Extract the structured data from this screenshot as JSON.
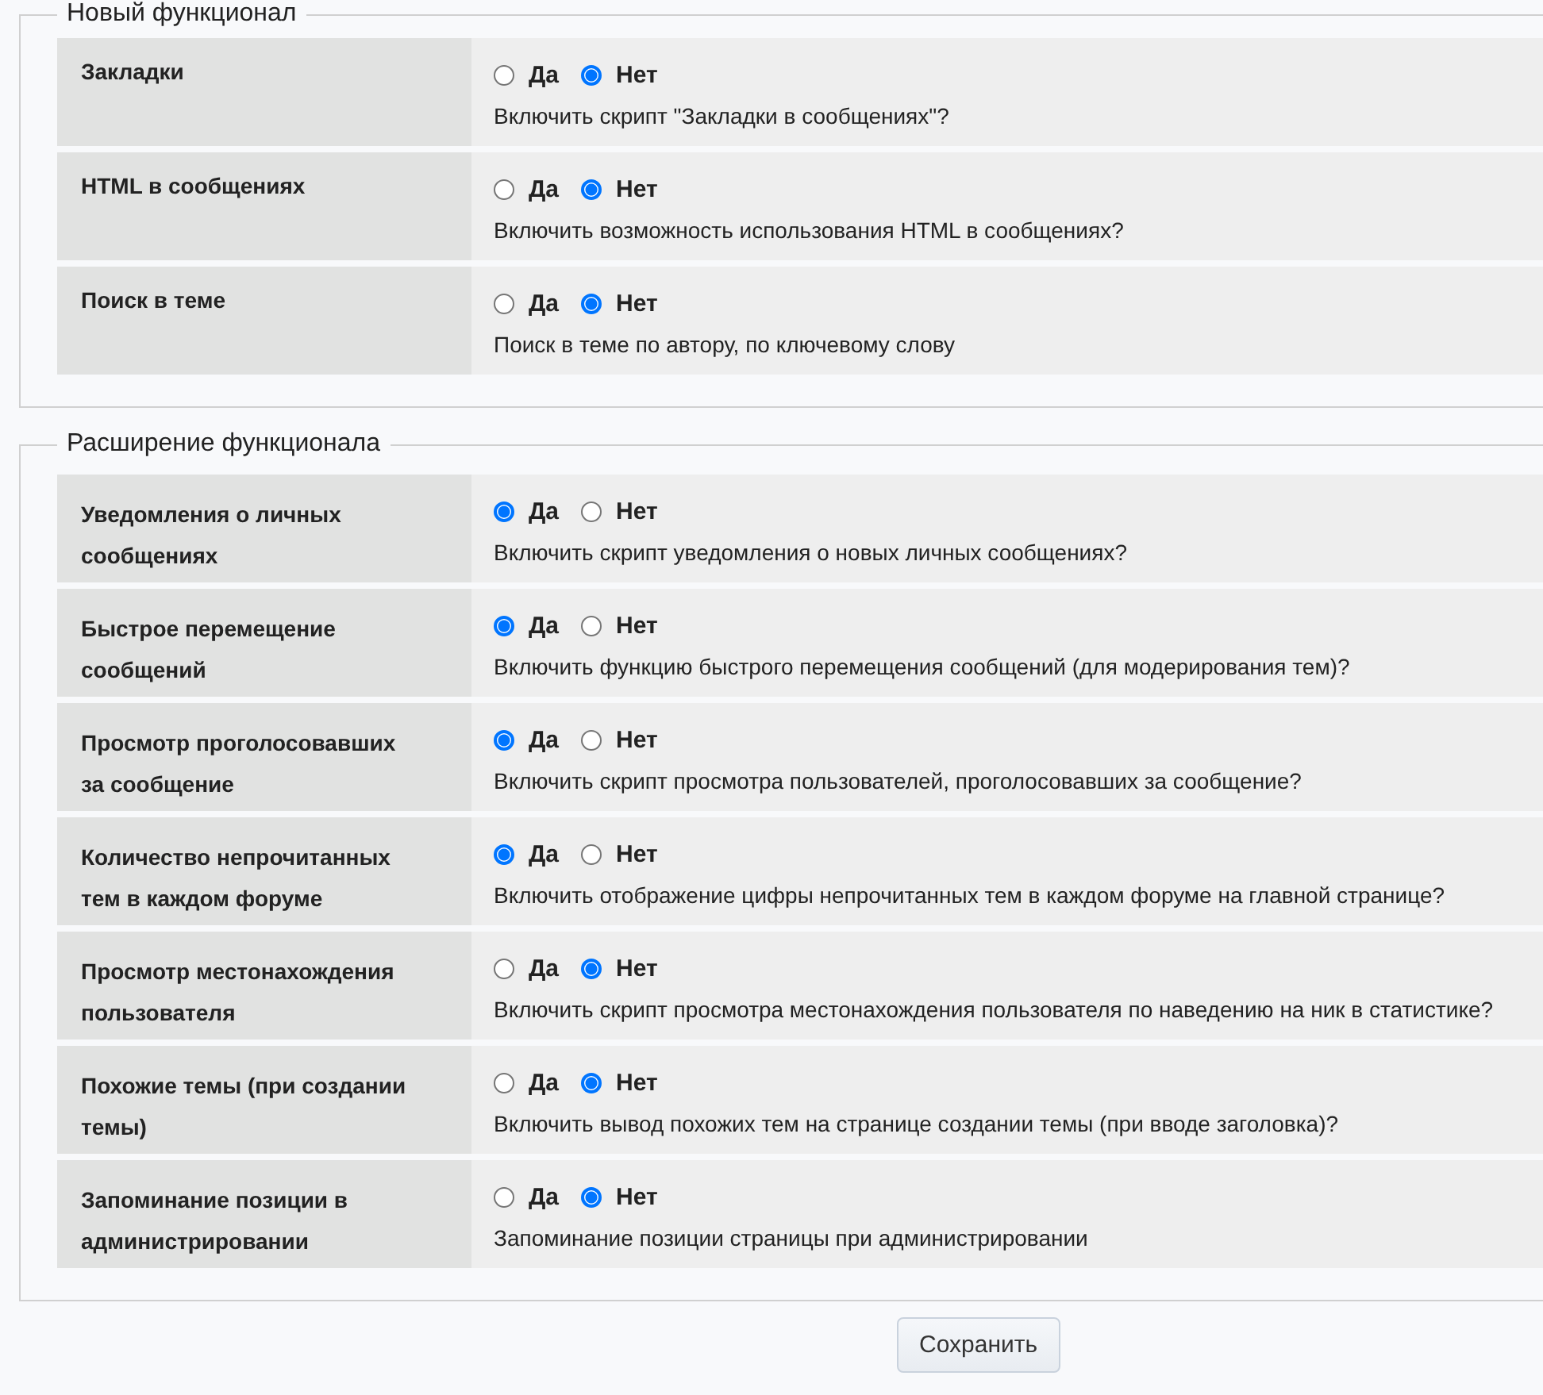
{
  "sections": [
    {
      "legend": "Новый функционал",
      "rows": [
        {
          "label": "Закладки",
          "options": [
            {
              "label": "Да",
              "selected": false
            },
            {
              "label": "Нет",
              "selected": true
            }
          ],
          "description": "Включить скрипт \"Закладки в сообщениях\"?"
        },
        {
          "label": "HTML в сообщениях",
          "options": [
            {
              "label": "Да",
              "selected": false
            },
            {
              "label": "Нет",
              "selected": true
            }
          ],
          "description": "Включить возможность использования HTML в сообщениях?"
        },
        {
          "label": "Поиск в теме",
          "options": [
            {
              "label": "Да",
              "selected": false
            },
            {
              "label": "Нет",
              "selected": true
            }
          ],
          "description": "Поиск в теме по автору, по ключевому слову"
        }
      ]
    },
    {
      "legend": "Расширение функционала",
      "rows": [
        {
          "label": "Уведомления о личных сообщениях",
          "options": [
            {
              "label": "Да",
              "selected": true
            },
            {
              "label": "Нет",
              "selected": false
            }
          ],
          "description": "Включить скрипт уведомления о новых личных сообщениях?"
        },
        {
          "label": "Быстрое перемещение сообщений",
          "options": [
            {
              "label": "Да",
              "selected": true
            },
            {
              "label": "Нет",
              "selected": false
            }
          ],
          "description": "Включить функцию быстрого перемещения сообщений (для модерирования тем)?"
        },
        {
          "label": "Просмотр проголосовавших за сообщение",
          "options": [
            {
              "label": "Да",
              "selected": true
            },
            {
              "label": "Нет",
              "selected": false
            }
          ],
          "description": "Включить скрипт просмотра пользователей, проголосовавших за сообщение?"
        },
        {
          "label": "Количество непрочитанных тем в каждом форуме",
          "options": [
            {
              "label": "Да",
              "selected": true
            },
            {
              "label": "Нет",
              "selected": false
            }
          ],
          "description": "Включить отображение цифры непрочитанных тем в каждом форуме на главной странице?"
        },
        {
          "label": "Просмотр местонахождения пользователя",
          "options": [
            {
              "label": "Да",
              "selected": false
            },
            {
              "label": "Нет",
              "selected": true
            }
          ],
          "description": "Включить скрипт просмотра местонахождения пользователя по наведению на ник в статистике?"
        },
        {
          "label": "Похожие темы (при создании темы)",
          "options": [
            {
              "label": "Да",
              "selected": false
            },
            {
              "label": "Нет",
              "selected": true
            }
          ],
          "description": "Включить вывод похожих тем на странице создании темы (при вводе заголовка)?"
        },
        {
          "label": "Запоминание позиции в администрировании",
          "options": [
            {
              "label": "Да",
              "selected": false
            },
            {
              "label": "Нет",
              "selected": true
            }
          ],
          "description": "Запоминание позиции страницы при администрировании"
        }
      ]
    }
  ],
  "save_button": "Сохранить"
}
